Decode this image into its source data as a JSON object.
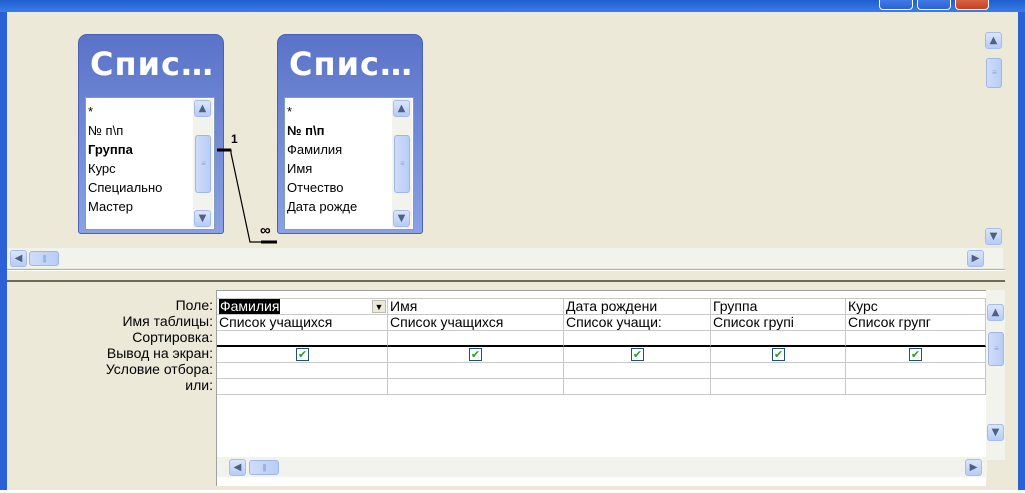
{
  "tables": [
    {
      "title": "Спис…",
      "fields": [
        {
          "name": "*",
          "bold": false
        },
        {
          "name": "№ п\\п",
          "bold": false
        },
        {
          "name": "Группа",
          "bold": true
        },
        {
          "name": "Курс",
          "bold": false
        },
        {
          "name": "Специально",
          "bold": false
        },
        {
          "name": "Мастер",
          "bold": false
        }
      ]
    },
    {
      "title": "Спис…",
      "fields": [
        {
          "name": "*",
          "bold": false
        },
        {
          "name": "№ п\\п",
          "bold": true
        },
        {
          "name": "Фамилия",
          "bold": false
        },
        {
          "name": "Имя",
          "bold": false
        },
        {
          "name": "Отчество",
          "bold": false
        },
        {
          "name": "Дата рожде",
          "bold": false
        }
      ]
    }
  ],
  "relationship": {
    "one_label": "1",
    "many_label": "∞"
  },
  "grid": {
    "row_labels": [
      "Поле:",
      "Имя таблицы:",
      "Сортировка:",
      "Вывод на экран:",
      "Условие отбора:",
      "или:"
    ],
    "columns": [
      {
        "field": "Фамилия",
        "table": "Список учащихся",
        "sort": "",
        "show": true,
        "criteria": "",
        "or": ""
      },
      {
        "field": "Имя",
        "table": "Список учащихся",
        "sort": "",
        "show": true,
        "criteria": "",
        "or": ""
      },
      {
        "field": "Дата рождени",
        "table": "Список учащи:",
        "sort": "",
        "show": true,
        "criteria": "",
        "or": ""
      },
      {
        "field": "Группа",
        "table": "Список групі",
        "sort": "",
        "show": true,
        "criteria": "",
        "or": ""
      },
      {
        "field": "Курс",
        "table": "Список групг",
        "sort": "",
        "show": true,
        "criteria": "",
        "or": ""
      }
    ]
  },
  "icons": {
    "scroll_up": "chevron-up-icon",
    "scroll_down": "chevron-down-icon",
    "scroll_left": "chevron-left-icon",
    "scroll_right": "chevron-right-icon",
    "dropdown": "dropdown-arrow-icon",
    "checkbox": "checkmark-icon"
  },
  "colors": {
    "window_frame": "#2c61d6",
    "field_list_header": "#5a73c8",
    "checkmark": "#21a121"
  }
}
